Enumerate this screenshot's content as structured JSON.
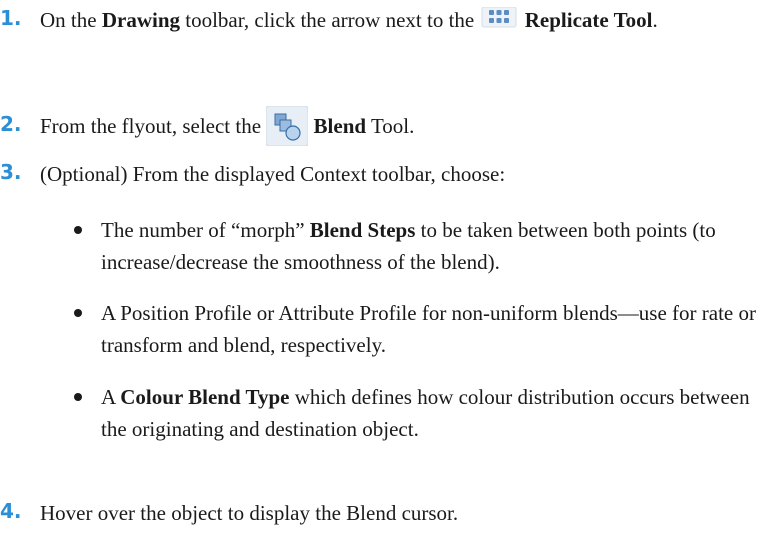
{
  "steps": [
    {
      "number": "1.",
      "parts": [
        "On the ",
        "Drawing",
        " toolbar, click the arrow next to the ",
        "Replicate Tool",
        "."
      ],
      "icon": "replicate-tool-icon"
    },
    {
      "number": "2.",
      "parts": [
        "From the flyout, select the ",
        "Blend",
        " Tool."
      ],
      "icon": "blend-tool-icon"
    },
    {
      "number": "3.",
      "parts": [
        "(Optional) From the displayed Context toolbar, choose:"
      ]
    },
    {
      "number": "4.",
      "parts": [
        "Hover over the object to display the Blend cursor."
      ]
    }
  ],
  "bullets": [
    {
      "parts": [
        "The number of “morph” ",
        "Blend Steps",
        " to be taken between both points (to increase/decrease the smoothness of the blend)."
      ]
    },
    {
      "parts": [
        "A Position Profile or Attribute Profile for non-uniform blends—use for rate or transform and blend, respectively."
      ]
    },
    {
      "parts": [
        "A ",
        "Colour Blend Type",
        " which defines how colour distribution occurs between the originating and destination object."
      ]
    }
  ],
  "colors": {
    "step_number": "#2b8fd6",
    "text": "#1a1a1a"
  }
}
